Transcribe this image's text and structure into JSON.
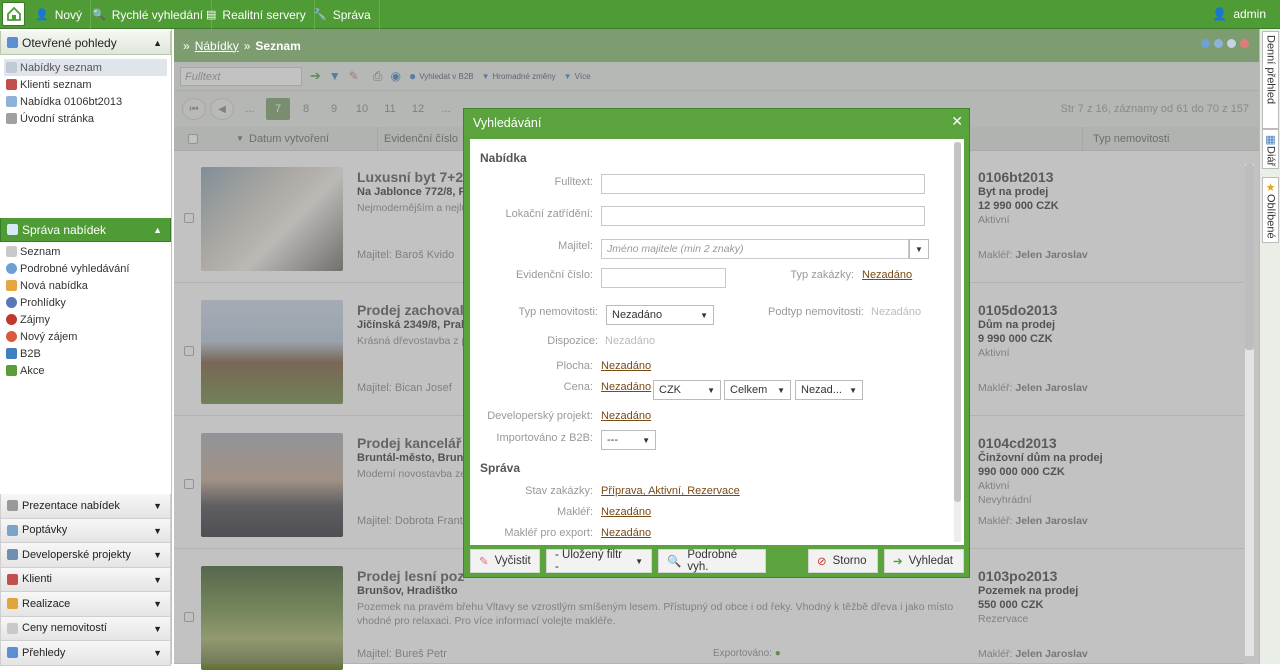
{
  "topnav": {
    "items": [
      {
        "label": "Nový",
        "icon": "person-add-icon"
      },
      {
        "label": "Rychlé vyhledání",
        "icon": "search-person-icon"
      },
      {
        "label": "Realitní servery",
        "icon": "servers-icon"
      },
      {
        "label": "Správa",
        "icon": "wrench-icon"
      }
    ],
    "user": "admin"
  },
  "left": {
    "open_views_title": "Otevřené pohledy",
    "open_views": [
      "Nabídky seznam",
      "Klienti seznam",
      "Nabídka 0106bt2013",
      "Úvodní stránka"
    ],
    "manage_title": "Správa nabídek",
    "manage_items": [
      "Seznam",
      "Podrobné vyhledávání",
      "Nová nabídka",
      "Prohlídky",
      "Zájmy",
      "Nový zájem",
      "B2B",
      "Akce"
    ],
    "bottom_sections": [
      "Prezentace nabídek",
      "Poptávky",
      "Developerské projekty",
      "Klienti",
      "Realizace",
      "Ceny nemovitostí",
      "Přehledy"
    ]
  },
  "breadcrumb": {
    "parent": "Nábídky",
    "sep": "»",
    "current": "Seznam"
  },
  "toolbar": {
    "fulltext_placeholder": "Fulltext",
    "b2b": "Vyhledat v B2B",
    "bulk": "Hromadné změny",
    "more": "Více"
  },
  "pager": {
    "pages": [
      "...",
      "7",
      "8",
      "9",
      "10",
      "11",
      "12",
      "..."
    ],
    "active": "7",
    "info": "Str 7 z 16, záznamy od 61 do 70 z 157"
  },
  "table": {
    "col_date": "Datum vytvoření",
    "col_id": "Evidenční číslo",
    "col_type": "Typ nemovitosti",
    "exported_label": "Exportováno:"
  },
  "rows": [
    {
      "title": "Luxusní byt 7+2",
      "addr": "Na Jablonce 772/8, P",
      "desc": "Nejmodernějším a nejlu... výhled na Prahu. Garáž...",
      "owner": "Majitel: Baroš Kvido",
      "id": "0106bt2013",
      "type": "Byt na prodej",
      "price": "12 990 000 CZK",
      "status": "Aktivní",
      "status2": "",
      "agent_label": "Makléř:",
      "agent": "Jelen Jaroslav"
    },
    {
      "title": "Prodej zachoval",
      "addr": "Jičínská 2349/8, Prah",
      "desc": "Krásná dřevostavba z p... komory a dvě koupelny... nepřůchozí a velmi dob...",
      "owner": "Majitel: Bican Josef",
      "id": "0105do2013",
      "type": "Dům na prodej",
      "price": "9 990 000 CZK",
      "status": "Aktivní",
      "status2": "",
      "agent_label": "Makléř:",
      "agent": "Jelen Jaroslav"
    },
    {
      "title": "Prodej kancelář",
      "addr": "Bruntál-město, Brunt",
      "desc": "Moderní novostavba ze... prostorách budovy. Ryc... financovat hypotékou. V...",
      "owner": "Majitel: Dobrota Františ",
      "id": "0104cd2013",
      "type": "Činžovní dům na prodej",
      "price": "990 000 000 CZK",
      "status": "Aktivní",
      "status2": "Nevyhrádní",
      "agent_label": "Makléř:",
      "agent": "Jelen Jaroslav"
    },
    {
      "title": "Prodej lesní poz",
      "addr": "Brunšov, Hradištko",
      "desc": "Pozemek na pravém břehu Vltavy se vzrostlým smíšeným lesem. Přístupný od obce i od řeky. Vhodný k těžbě dřeva i jako místo vhodné pro relaxaci. Pro více informací volejte makléře.",
      "owner": "Majitel: Bureš Petr",
      "id": "0103po2013",
      "type": "Pozemek na prodej",
      "price": "550 000 CZK",
      "status": "Rezervace",
      "status2": "",
      "agent_label": "Makléř:",
      "agent": "Jelen Jaroslav"
    }
  ],
  "rightbar": {
    "tabs": [
      "Denní přehled",
      "Diář",
      "Oblíbené"
    ]
  },
  "modal": {
    "title": "Vyhledávání",
    "sec_offer": "Nabídka",
    "fulltext": "Fulltext:",
    "location": "Lokační zatřídění:",
    "owner": "Majitel:",
    "owner_placeholder": "Jméno majitele (min 2 znaky)",
    "evid": "Evidenční číslo:",
    "order_type": "Typ zakázky:",
    "order_type_val": "Nezadáno",
    "prop_type": "Typ nemovitosti:",
    "prop_type_val": "Nezadáno",
    "sub_type": "Podtyp nemovitosti:",
    "sub_type_val": "Nezadáno",
    "disp": "Dispozice:",
    "disp_val": "Nezadáno",
    "area": "Plocha:",
    "area_val": "Nezadáno",
    "price": "Cena:",
    "price_val": "Nezadáno",
    "currency": "CZK",
    "total": "Celkem",
    "price_sel": "Nezad...",
    "dev": "Developerský projekt:",
    "dev_val": "Nezadáno",
    "imp": "Importováno z B2B:",
    "imp_val": "---",
    "sec_manage": "Správa",
    "state": "Stav zakázky:",
    "state_val": "Příprava, Aktivní, Rezervace",
    "agent": "Makléř:",
    "agent_val": "Nezadáno",
    "agent_exp": "Makléř pro export:",
    "agent_exp_val": "Nezadáno",
    "btn_clear": "Vyčistit",
    "btn_saved": "- Uložený filtr -",
    "btn_adv": "Podrobné vyh.",
    "btn_cancel": "Storno",
    "btn_search": "Vyhledat"
  }
}
